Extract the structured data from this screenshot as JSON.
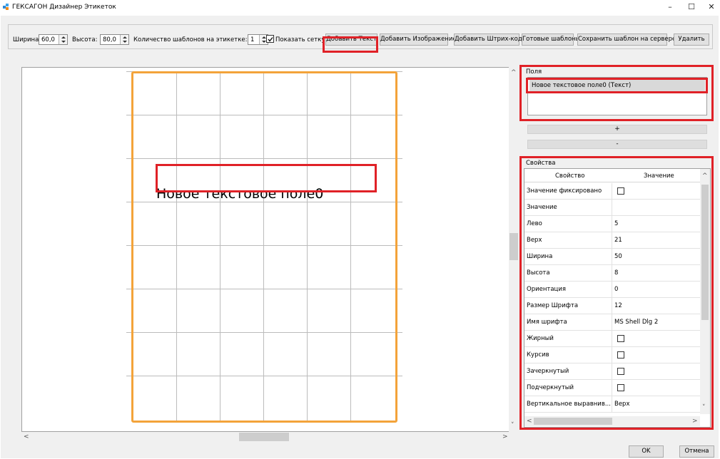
{
  "window": {
    "title": "ГЕКСАГОН Дизайнер Этикеток",
    "minimize": "–",
    "maximize": "☐",
    "close": "✕"
  },
  "toolbar": {
    "width_label": "Ширина:",
    "width_value": "60,0",
    "height_label": "Высота:",
    "height_value": "80,0",
    "templates_label": "Количество шаблонов на этикетке:",
    "templates_value": "1",
    "show_grid_label": "Показать сетку",
    "show_grid_checked": true,
    "buttons": {
      "add_text": "Добавить Текст",
      "add_image": "Добавить Изображение",
      "add_barcode": "Добавить Штрих-код",
      "ready_templates": "Готовые шаблоны",
      "save_server": "Сохранить шаблон на сервере",
      "delete": "Удалить"
    }
  },
  "canvas": {
    "text_field": "Новое текстовое поле0"
  },
  "fields_panel": {
    "title": "Поля",
    "items": [
      "Новое текстовое поле0 (Текст)"
    ],
    "add_button": "+",
    "remove_button": "-"
  },
  "properties_panel": {
    "title": "Свойства",
    "col_property": "Свойство",
    "col_value": "Значение",
    "rows": [
      {
        "name": "Значение фиксировано",
        "value": "",
        "checkbox": true
      },
      {
        "name": "Значение",
        "value": ""
      },
      {
        "name": "Лево",
        "value": "5"
      },
      {
        "name": "Верх",
        "value": "21"
      },
      {
        "name": "Ширина",
        "value": "50"
      },
      {
        "name": "Высота",
        "value": "8"
      },
      {
        "name": "Ориентация",
        "value": "0"
      },
      {
        "name": "Размер Шрифта",
        "value": "12"
      },
      {
        "name": "Имя шрифта",
        "value": "MS Shell Dlg 2"
      },
      {
        "name": "Жирный",
        "value": "",
        "checkbox": true
      },
      {
        "name": "Курсив",
        "value": "",
        "checkbox": true
      },
      {
        "name": "Зачеркнутый",
        "value": "",
        "checkbox": true
      },
      {
        "name": "Подчеркнутый",
        "value": "",
        "checkbox": true
      },
      {
        "name": "Вертикальное выравнив...",
        "value": "Верх"
      }
    ]
  },
  "dialog": {
    "ok": "OK",
    "cancel": "Отмена"
  },
  "colors": {
    "highlight": "#e02127",
    "label_border": "#f3a33a",
    "grid": "#bcbcbc"
  }
}
